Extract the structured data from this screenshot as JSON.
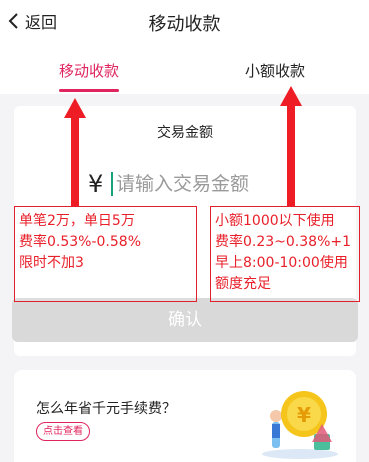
{
  "header": {
    "back_label": "返回",
    "title": "移动收款"
  },
  "tabs": [
    {
      "label": "移动收款",
      "active": true
    },
    {
      "label": "小额收款",
      "active": false
    }
  ],
  "payment": {
    "section_title": "交易金额",
    "currency_symbol": "¥",
    "placeholder": "请输入交易金额",
    "confirm_label": "确认"
  },
  "annotations": {
    "left": [
      "单笔2万，单日5万",
      "费率0.53%-0.58%",
      "限时不加3"
    ],
    "right": [
      "小额1000以下使用",
      "费率0.23~0.38%+1",
      "早上8:00-10:00使用",
      "额度充足"
    ]
  },
  "promo": {
    "text": "怎么年省千元手续费？",
    "button_label": "点击查看"
  },
  "colors": {
    "accent": "#e0245e",
    "annotation": "#e8202a",
    "disabled_button": "#d9d9d9"
  }
}
